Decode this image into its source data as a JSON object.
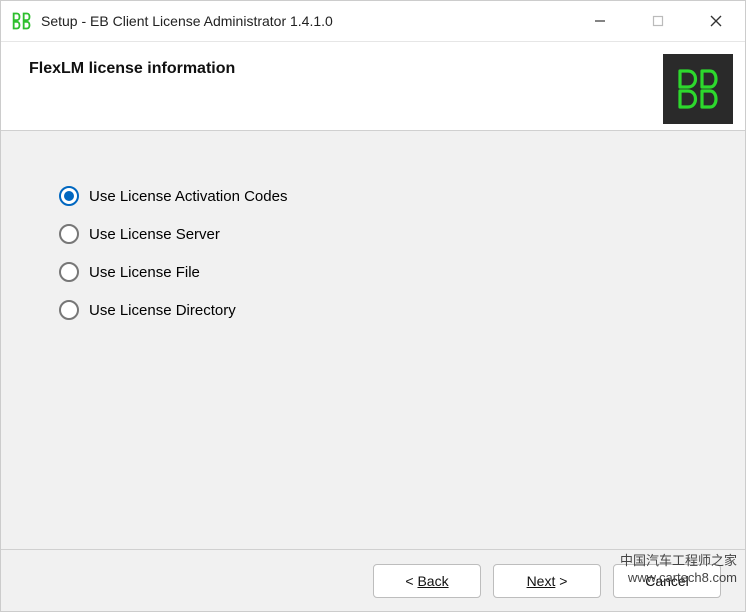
{
  "titlebar": {
    "title": "Setup - EB Client License Administrator 1.4.1.0"
  },
  "header": {
    "title": "FlexLM license information"
  },
  "options": [
    {
      "label": "Use License Activation Codes",
      "selected": true
    },
    {
      "label": "Use License Server",
      "selected": false
    },
    {
      "label": "Use License File",
      "selected": false
    },
    {
      "label": "Use License Directory",
      "selected": false
    }
  ],
  "footer": {
    "back_label": "Back",
    "next_label": "Next",
    "cancel_label": "Cancel"
  },
  "watermark": {
    "line1": "中国汽车工程师之家",
    "line2": "www.cartech8.com"
  }
}
